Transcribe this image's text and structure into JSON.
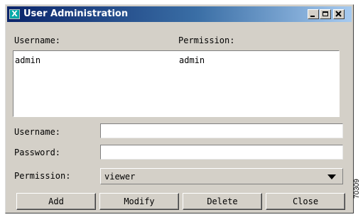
{
  "window": {
    "title": "User Administration",
    "app_icon_glyph": "X",
    "controls": [
      "minimize-icon",
      "maximize-icon",
      "close-icon"
    ]
  },
  "list": {
    "headers": {
      "username": "Username:",
      "permission": "Permission:"
    },
    "rows": [
      {
        "username": "admin",
        "permission": "admin"
      }
    ]
  },
  "form": {
    "username_label": "Username:",
    "username_value": "",
    "password_label": "Password:",
    "password_value": "",
    "permission_label": "Permission:",
    "permission_value": "viewer"
  },
  "buttons": {
    "add": "Add",
    "modify": "Modify",
    "delete": "Delete",
    "close": "Close"
  },
  "figure_id": "70309"
}
